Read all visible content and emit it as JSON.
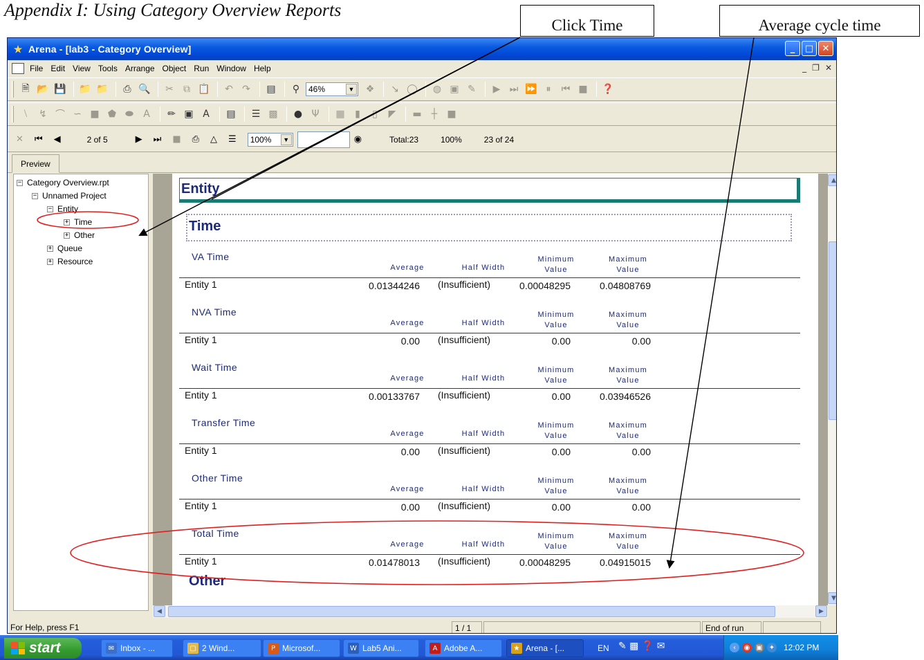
{
  "document": {
    "heading": "Appendix I: Using Category Overview Reports",
    "callout_click_time": "Click Time",
    "callout_avg_cycle": "Average cycle time"
  },
  "window": {
    "title": "Arena - [lab3 - Category Overview]",
    "menu": [
      "File",
      "Edit",
      "View",
      "Tools",
      "Arrange",
      "Object",
      "Run",
      "Window",
      "Help"
    ],
    "zoom_toolbar_value": "46%"
  },
  "report_nav": {
    "page_indicator": "2 of 5",
    "zoom_value": "100%",
    "search_value": "",
    "total": "Total:23",
    "percent": "100%",
    "count": "23 of 24"
  },
  "tab": "Preview",
  "tree": {
    "root": "Category Overview.rpt",
    "project": "Unnamed Project",
    "entity": "Entity",
    "time": "Time",
    "other": "Other",
    "queue": "Queue",
    "resource": "Resource"
  },
  "report": {
    "entity_header": "Entity",
    "time_header": "Time",
    "col_average": "Average",
    "col_halfwidth": "Half Width",
    "col_min_1": "Minimum",
    "col_min_2": "Value",
    "col_max_1": "Maximum",
    "col_max_2": "Value",
    "sections": [
      {
        "name": "VA Time",
        "entity": "Entity 1",
        "average": "0.01344246",
        "half_width": "(Insufficient)",
        "minimum": "0.00048295",
        "maximum": "0.04808769"
      },
      {
        "name": "NVA Time",
        "entity": "Entity 1",
        "average": "0.00",
        "half_width": "(Insufficient)",
        "minimum": "0.00",
        "maximum": "0.00"
      },
      {
        "name": "Wait Time",
        "entity": "Entity 1",
        "average": "0.00133767",
        "half_width": "(Insufficient)",
        "minimum": "0.00",
        "maximum": "0.03946526"
      },
      {
        "name": "Transfer Time",
        "entity": "Entity 1",
        "average": "0.00",
        "half_width": "(Insufficient)",
        "minimum": "0.00",
        "maximum": "0.00"
      },
      {
        "name": "Other Time",
        "entity": "Entity 1",
        "average": "0.00",
        "half_width": "(Insufficient)",
        "minimum": "0.00",
        "maximum": "0.00"
      },
      {
        "name": "Total Time",
        "entity": "Entity 1",
        "average": "0.01478013",
        "half_width": "(Insufficient)",
        "minimum": "0.00048295",
        "maximum": "0.04915015"
      }
    ],
    "other_header": "Other"
  },
  "status": {
    "help": "For Help, press F1",
    "page": "1 / 1",
    "run_state": "End of run"
  },
  "taskbar": {
    "start": "start",
    "buttons": [
      "Inbox - ...",
      "2 Wind...",
      "Microsof...",
      "Lab5 Ani...",
      "Adobe A...",
      "Arena - [..."
    ],
    "lang": "EN",
    "clock": "12:02 PM"
  },
  "colors": {
    "annotation_ellipse": "#e02020",
    "report_navy": "#1c2a7a",
    "section_rule": "#7a1e1e",
    "xp_title_blue": "#0148d8"
  }
}
